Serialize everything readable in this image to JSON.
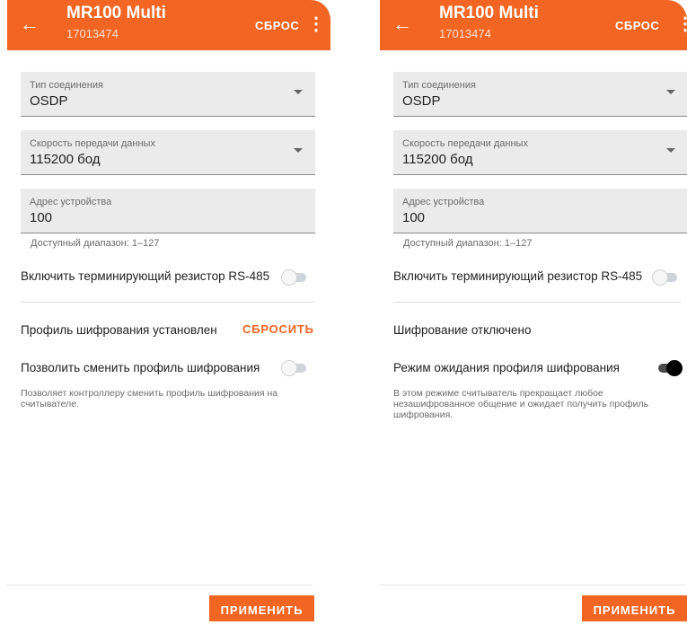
{
  "colors": {
    "accent": "#F26522"
  },
  "screens": [
    {
      "header": {
        "back_icon": "arrow-left-icon",
        "title": "MR100 Multi",
        "serial": "17013474",
        "reset_label": "СБРОС",
        "menu_icon": "more-vert-icon"
      },
      "fields": [
        {
          "label": "Тип соединения",
          "value": "OSDP",
          "dropdown": true
        },
        {
          "label": "Скорость передачи данных",
          "value": "115200 бод",
          "dropdown": true
        },
        {
          "label": "Адрес устройства",
          "value": "100",
          "dropdown": false
        }
      ],
      "address_hint": "Доступный диапазон: 1–127",
      "termination_label": "Включить терминирующий резистор RS-485",
      "termination_on": false,
      "encryption_status": "Профиль шифрования установлен",
      "encryption_reset_link": "СБРОСИТЬ",
      "option_label": "Позволить сменить профиль шифрования",
      "option_on": false,
      "option_description": "Позволяет контроллеру сменить профиль шифрования на считывателе.",
      "apply_label": "ПРИМЕНИТЬ"
    },
    {
      "header": {
        "back_icon": "arrow-left-icon",
        "title": "MR100 Multi",
        "serial": "17013474",
        "reset_label": "СБРОС",
        "menu_icon": "more-vert-icon"
      },
      "fields": [
        {
          "label": "Тип соединения",
          "value": "OSDP",
          "dropdown": true
        },
        {
          "label": "Скорость передачи данных",
          "value": "115200 бод",
          "dropdown": true
        },
        {
          "label": "Адрес устройства",
          "value": "100",
          "dropdown": false
        }
      ],
      "address_hint": "Доступный диапазон: 1–127",
      "termination_label": "Включить терминирующий резистор RS-485",
      "termination_on": false,
      "encryption_status": "Шифрование отключено",
      "option_label": "Режим ожидания профиля шифрования",
      "option_on": true,
      "option_description": "В этом режиме считыватель прекращает любое незашифрованное общение и ожидает получить профиль шифрования.",
      "apply_label": "ПРИМЕНИТЬ"
    }
  ]
}
